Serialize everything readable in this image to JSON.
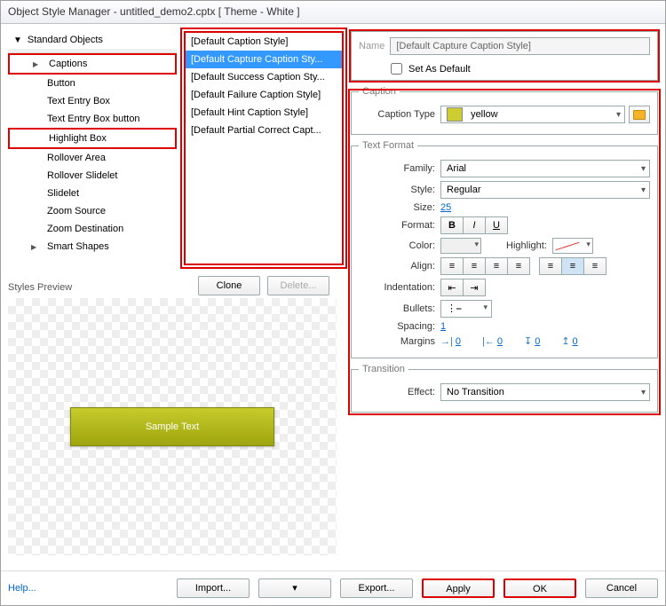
{
  "window": {
    "title": "Object Style Manager - untitled_demo2.cptx [ Theme - White ]"
  },
  "tree": {
    "root": "Standard Objects",
    "items": [
      {
        "label": "Captions",
        "hasArrow": true,
        "red": true
      },
      {
        "label": "Button"
      },
      {
        "label": "Text Entry Box"
      },
      {
        "label": "Text Entry Box button"
      },
      {
        "label": "Highlight Box",
        "red": true
      },
      {
        "label": "Rollover Area"
      },
      {
        "label": "Rollover Slidelet"
      },
      {
        "label": "Slidelet"
      },
      {
        "label": "Zoom Source"
      },
      {
        "label": "Zoom Destination"
      },
      {
        "label": "Smart Shapes",
        "hasArrow": true
      }
    ]
  },
  "styleList": {
    "items": [
      "[Default Caption Style]",
      "[Default Capture Caption Sty...",
      "[Default Success Caption Sty...",
      "[Default Failure Caption Style]",
      "[Default Hint Caption Style]",
      "[Default Partial Correct Capt..."
    ],
    "selectedIndex": 1,
    "clone": "Clone",
    "delete": "Delete..."
  },
  "nameBox": {
    "label": "Name",
    "value": "[Default Capture Caption Style]",
    "setDefault": "Set As Default"
  },
  "caption": {
    "legend": "Caption",
    "typeLabel": "Caption Type",
    "typeValue": "yellow"
  },
  "textFormat": {
    "legend": "Text Format",
    "familyLabel": "Family:",
    "familyValue": "Arial",
    "styleLabel": "Style:",
    "styleValue": "Regular",
    "sizeLabel": "Size:",
    "sizeValue": "25",
    "formatLabel": "Format:",
    "colorLabel": "Color:",
    "highlightLabel": "Highlight:",
    "alignLabel": "Align:",
    "indentLabel": "Indentation:",
    "bulletsLabel": "Bullets:",
    "spacingLabel": "Spacing:",
    "spacingValue": "1",
    "marginsLabel": "Margins",
    "marginVals": [
      "0",
      "0",
      "0",
      "0"
    ]
  },
  "transition": {
    "legend": "Transition",
    "effectLabel": "Effect:",
    "effectValue": "No Transition"
  },
  "preview": {
    "label": "Styles Preview",
    "sample": "Sample Text"
  },
  "footer": {
    "help": "Help...",
    "import": "Import...",
    "export": "Export...",
    "apply": "Apply",
    "ok": "OK",
    "cancel": "Cancel"
  }
}
